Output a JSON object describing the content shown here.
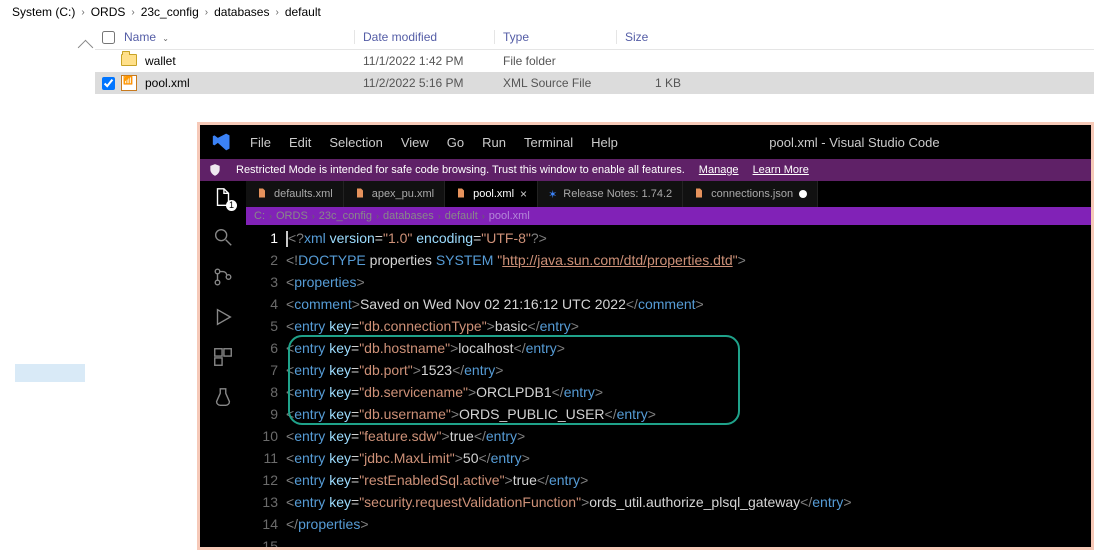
{
  "breadcrumb": [
    "System (C:)",
    "ORDS",
    "23c_config",
    "databases",
    "default"
  ],
  "columns": {
    "name": "Name",
    "date": "Date modified",
    "type": "Type",
    "size": "Size"
  },
  "rows": [
    {
      "checked": false,
      "icon": "folder",
      "name": "wallet",
      "date": "11/1/2022 1:42 PM",
      "type": "File folder",
      "size": ""
    },
    {
      "checked": true,
      "icon": "xml",
      "name": "pool.xml",
      "date": "11/2/2022 5:16 PM",
      "type": "XML Source File",
      "size": "1 KB"
    }
  ],
  "vsc": {
    "menus": [
      "File",
      "Edit",
      "Selection",
      "View",
      "Go",
      "Run",
      "Terminal",
      "Help"
    ],
    "title": "pool.xml - Visual Studio Code",
    "restrict_msg": "Restricted Mode is intended for safe code browsing. Trust this window to enable all features.",
    "restrict_links": [
      "Manage",
      "Learn More"
    ],
    "tabs": [
      {
        "label": "defaults.xml",
        "active": false,
        "dirty": false,
        "close": false
      },
      {
        "label": "apex_pu.xml",
        "active": false,
        "dirty": false,
        "close": false
      },
      {
        "label": "pool.xml",
        "active": true,
        "dirty": false,
        "close": true
      },
      {
        "label": "Release Notes: 1.74.2",
        "active": false,
        "dirty": false,
        "close": false,
        "release": true
      },
      {
        "label": "connections.json",
        "active": false,
        "dirty": true,
        "close": false
      }
    ],
    "crumb": [
      "C:",
      "ORDS",
      "23c_config",
      "databases",
      "default",
      "pool.xml"
    ],
    "code_lines": 15,
    "xml": {
      "decl_version": "1.0",
      "decl_encoding": "UTF-8",
      "doctype_root": "properties",
      "doctype_system": "http://java.sun.com/dtd/properties.dtd",
      "root": "properties",
      "comment": "Saved on Wed Nov 02 21:16:12 UTC 2022",
      "entries": [
        {
          "key": "db.connectionType",
          "value": "basic"
        },
        {
          "key": "db.hostname",
          "value": "localhost"
        },
        {
          "key": "db.port",
          "value": "1523"
        },
        {
          "key": "db.servicename",
          "value": "ORCLPDB1"
        },
        {
          "key": "db.username",
          "value": "ORDS_PUBLIC_USER"
        },
        {
          "key": "feature.sdw",
          "value": "true"
        },
        {
          "key": "jdbc.MaxLimit",
          "value": "50"
        },
        {
          "key": "restEnabledSql.active",
          "value": "true"
        },
        {
          "key": "security.requestValidationFunction",
          "value": "ords_util.authorize_plsql_gateway"
        }
      ]
    },
    "highlight": {
      "from_line": 6,
      "to_line": 9
    }
  }
}
